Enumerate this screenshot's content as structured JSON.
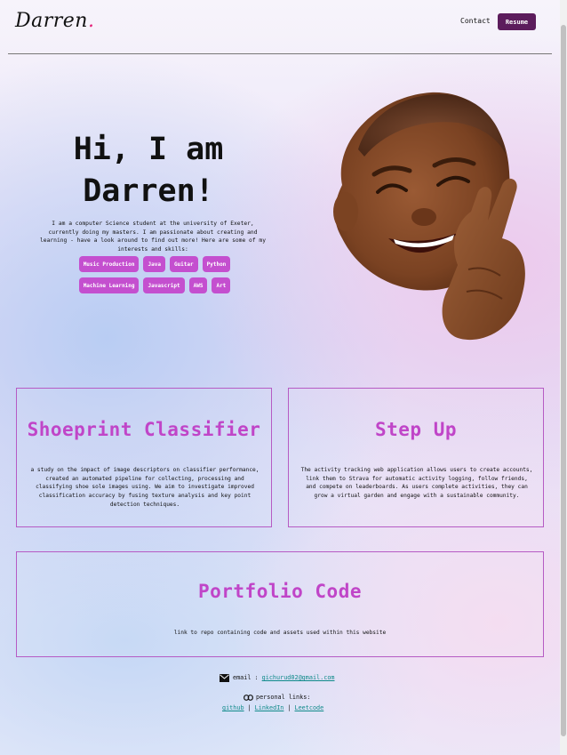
{
  "header": {
    "logo_text": "Darren",
    "logo_dot": ".",
    "contact_label": "Contact",
    "resume_label": "Resume"
  },
  "hero": {
    "title_line1": "Hi, I am",
    "title_line2": "Darren!",
    "description": "I am a computer Science student at the university of Exeter, currently doing my masters. I am passionate about creating and learning - have a look around to find out more! Here are some of my interests and skills:",
    "tags_row1": [
      "Music Production",
      "Java",
      "Guitar",
      "Python"
    ],
    "tags_row2": [
      "Machine Learning",
      "Javascript",
      "AWS",
      "Art"
    ]
  },
  "projects": [
    {
      "title": "Shoeprint Classifier",
      "description": "a study on the impact of image descriptors on classifier performance, created an automated pipeline for collecting, processing and classifying shoe sole images using. We aim to investigate improved classification accuracy by fusing texture analysis and key point detection techniques."
    },
    {
      "title": "Step Up",
      "description": "The activity tracking web application allows users to create accounts, link them to Strava for automatic activity logging, follow friends, and compete on leaderboards. As users complete activities, they can grow a virtual garden and engage with a sustainable community."
    },
    {
      "title": "Portfolio Code",
      "description": "link to repo containing code and assets used within this website"
    }
  ],
  "footer": {
    "email_label": "email :",
    "email_value": "gichurud02@gmail.com",
    "personal_links_label": "personal links:",
    "links": [
      "github",
      "LinkedIn",
      "Leetcode"
    ],
    "separator": "|"
  },
  "icons": {
    "email": "envelope-icon",
    "personal_links": "link-icon"
  },
  "colors": {
    "accent": "#c045c8",
    "tag_bg": "#c44fcf",
    "resume_bg": "#5c1c5c",
    "link": "#0f8a8a",
    "logo_dot": "#e5247b"
  }
}
